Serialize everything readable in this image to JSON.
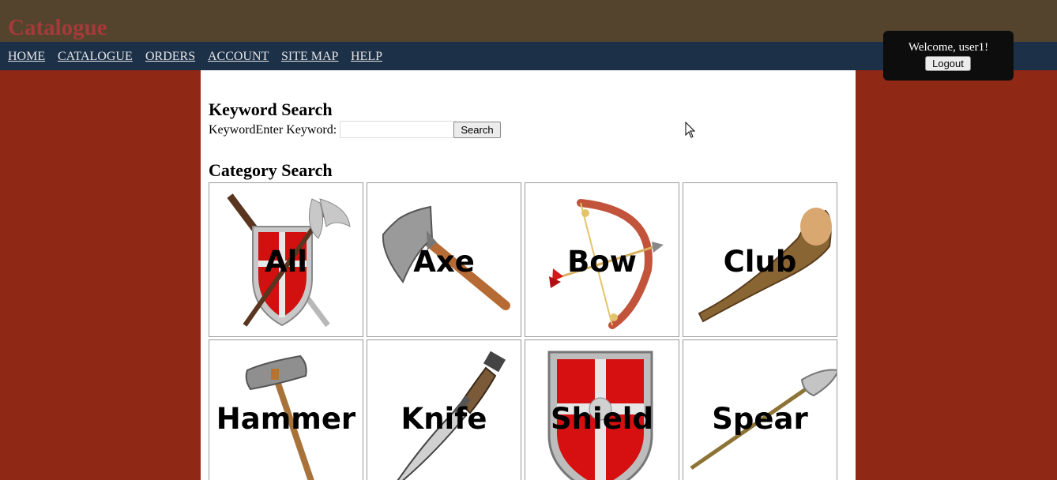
{
  "header": {
    "title": "Catalogue"
  },
  "nav": [
    {
      "label": "HOME"
    },
    {
      "label": "CATALOGUE"
    },
    {
      "label": "ORDERS"
    },
    {
      "label": "ACCOUNT"
    },
    {
      "label": "SITE MAP"
    },
    {
      "label": "HELP"
    }
  ],
  "user": {
    "welcome": "Welcome, user1!",
    "logout_label": "Logout"
  },
  "keyword_search": {
    "heading": "Keyword Search",
    "label": "KeywordEnter Keyword:",
    "value": "",
    "button_label": "Search"
  },
  "category_search": {
    "heading": "Category Search",
    "categories": [
      {
        "label": "All",
        "icon": "shield-crossed-weapons-icon"
      },
      {
        "label": "Axe",
        "icon": "axe-icon"
      },
      {
        "label": "Bow",
        "icon": "bow-icon"
      },
      {
        "label": "Club",
        "icon": "club-icon"
      },
      {
        "label": "Hammer",
        "icon": "hammer-icon"
      },
      {
        "label": "Knife",
        "icon": "knife-icon"
      },
      {
        "label": "Shield",
        "icon": "shield-icon"
      },
      {
        "label": "Spear",
        "icon": "spear-icon"
      }
    ]
  },
  "colors": {
    "header_bg": "#54442d",
    "nav_bg": "#1c3048",
    "page_bg": "#8f2814",
    "title_color": "#a53a3a"
  }
}
